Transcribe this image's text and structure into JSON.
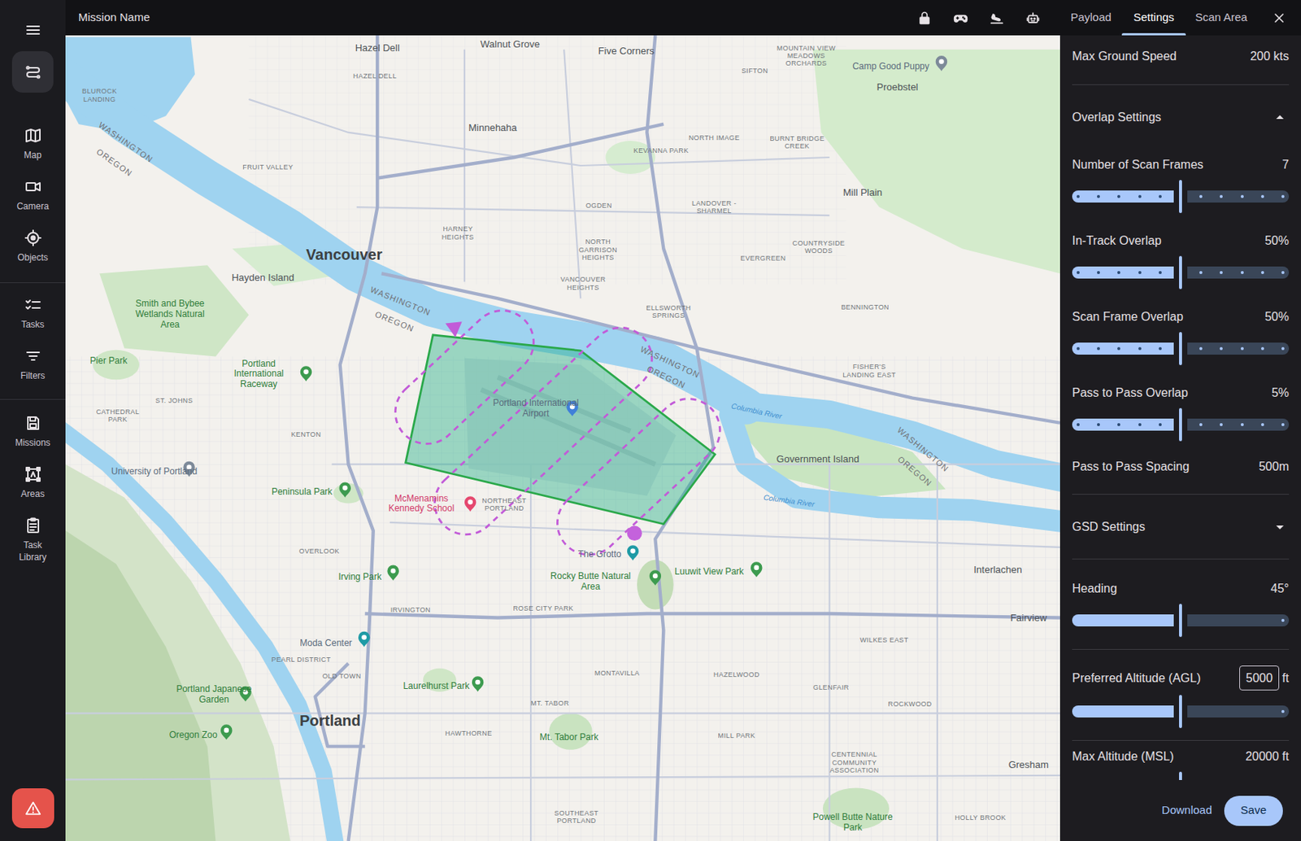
{
  "top_bar": {
    "title": "Mission Name"
  },
  "sidebar": {
    "layers_button": {
      "selected": true
    },
    "groups": [
      [
        {
          "label": "Map",
          "selected": false
        },
        {
          "label": "Camera",
          "selected": false
        },
        {
          "label": "Objects",
          "selected": false
        }
      ],
      [
        {
          "label": "Tasks",
          "selected": false
        },
        {
          "label": "Filters",
          "selected": false
        }
      ],
      [
        {
          "label": "Missions",
          "selected": false
        },
        {
          "label": "Areas",
          "selected": false
        },
        {
          "label": "Task Library",
          "selected": false
        }
      ]
    ]
  },
  "tabs": [
    {
      "label": "Payload",
      "selected": false
    },
    {
      "label": "Settings",
      "selected": true
    },
    {
      "label": "Scan Area",
      "selected": false
    }
  ],
  "settings": {
    "groups": [
      {
        "rows": [
          {
            "kind": "value",
            "label": "Max Ground Speed",
            "value": "200 kts"
          }
        ]
      },
      {
        "header": {
          "label": "Overlap Settings",
          "expanded": true
        },
        "rows": [
          {
            "kind": "stepped",
            "label": "Number of Scan Frames",
            "value": "7",
            "level": 0.5
          },
          {
            "kind": "stepped",
            "label": "In-Track Overlap",
            "value": "50%",
            "level": 0.5
          },
          {
            "kind": "stepped",
            "label": "Scan Frame Overlap",
            "value": "50%",
            "level": 0.5
          },
          {
            "kind": "stepped",
            "label": "Pass to Pass Overlap",
            "value": "5%",
            "level": 0.5
          },
          {
            "kind": "value",
            "label": "Pass to Pass Spacing",
            "value": "500m"
          }
        ]
      },
      {
        "header": {
          "label": "GSD Settings",
          "expanded": false
        },
        "rows": []
      },
      {
        "rows": [
          {
            "kind": "slider",
            "label": "Heading",
            "value": "45°",
            "level": 0.5
          }
        ]
      },
      {
        "rows": [
          {
            "kind": "input",
            "label": "Preferred Altitude (AGL)",
            "value": "5000",
            "unit": "ft",
            "level": 0.5
          }
        ]
      },
      {
        "rows": [
          {
            "kind": "slider",
            "label": "Max Altitude (MSL)",
            "value": "20000 ft",
            "level": 0.5
          }
        ]
      }
    ]
  },
  "footer": {
    "buttons": [
      {
        "label": "Download",
        "kind": "text"
      },
      {
        "label": "Save",
        "kind": "filled"
      }
    ]
  },
  "map": {
    "labels": [
      {
        "text": "Hazel Dell",
        "kind": "town"
      },
      {
        "text": "Walnut Grove",
        "kind": "town"
      },
      {
        "text": "Five Corners",
        "kind": "town"
      },
      {
        "text": "Minnehaha",
        "kind": "town"
      },
      {
        "text": "Vancouver",
        "kind": "city"
      },
      {
        "text": "Hayden Island",
        "kind": "town"
      },
      {
        "text": "Smith and Bybee Wetlands Natural Area",
        "kind": "park"
      },
      {
        "text": "Pier Park",
        "kind": "park"
      },
      {
        "text": "Portland International Raceway",
        "kind": "park"
      },
      {
        "text": "Portland International Airport",
        "kind": "poi"
      },
      {
        "text": "Government Island",
        "kind": "town"
      },
      {
        "text": "Mill Plain",
        "kind": "town"
      },
      {
        "text": "Proebstel",
        "kind": "town"
      },
      {
        "text": "Camp Good Puppy",
        "kind": "poi"
      },
      {
        "text": "Peninsula Park",
        "kind": "park"
      },
      {
        "text": "University of Portland",
        "kind": "poi"
      },
      {
        "text": "McMenamins Kennedy School",
        "kind": "red"
      },
      {
        "text": "The Grotto",
        "kind": "poi"
      },
      {
        "text": "Rocky Butte Natural Area",
        "kind": "park"
      },
      {
        "text": "Luuwit View Park",
        "kind": "park"
      },
      {
        "text": "Irving Park",
        "kind": "park"
      },
      {
        "text": "Moda Center",
        "kind": "poi"
      },
      {
        "text": "Laurelhurst Park",
        "kind": "park"
      },
      {
        "text": "Mt. Tabor Park",
        "kind": "park"
      },
      {
        "text": "Portland",
        "kind": "city"
      },
      {
        "text": "Portland Japanese Garden",
        "kind": "park"
      },
      {
        "text": "Oregon Zoo",
        "kind": "park"
      },
      {
        "text": "Interlachen",
        "kind": "town"
      },
      {
        "text": "Fairview",
        "kind": "town"
      },
      {
        "text": "Gresham",
        "kind": "town"
      },
      {
        "text": "Powell Butte Nature Park",
        "kind": "park"
      },
      {
        "text": "Columbia River",
        "kind": "water"
      },
      {
        "text": "Columbia River",
        "kind": "water"
      },
      {
        "text": "WASHINGTON",
        "kind": "state"
      },
      {
        "text": "OREGON",
        "kind": "state"
      },
      {
        "text": "WASHINGTON",
        "kind": "state"
      },
      {
        "text": "OREGON",
        "kind": "state"
      },
      {
        "text": "WASHINGTON",
        "kind": "state"
      },
      {
        "text": "OREGON",
        "kind": "state"
      },
      {
        "text": "WASHINGTON",
        "kind": "state"
      },
      {
        "text": "OREGON",
        "kind": "state"
      },
      {
        "text": "NORTH IMAGE",
        "kind": "hood"
      },
      {
        "text": "KEVANNA PARK",
        "kind": "hood"
      },
      {
        "text": "OGDEN",
        "kind": "hood"
      },
      {
        "text": "HARNEY HEIGHTS",
        "kind": "hood"
      },
      {
        "text": "NORTH GARRISON HEIGHTS",
        "kind": "hood"
      },
      {
        "text": "VANCOUVER HEIGHTS",
        "kind": "hood"
      },
      {
        "text": "ELLSWORTH SPRINGS",
        "kind": "hood"
      },
      {
        "text": "EVERGREEN",
        "kind": "hood"
      },
      {
        "text": "BENNINGTON",
        "kind": "hood"
      },
      {
        "text": "FISHER'S LANDING EAST",
        "kind": "hood"
      },
      {
        "text": "ST. JOHNS",
        "kind": "hood"
      },
      {
        "text": "KENTON",
        "kind": "hood"
      },
      {
        "text": "NORTHEAST PORTLAND",
        "kind": "hood"
      },
      {
        "text": "IRVINGTON",
        "kind": "hood"
      },
      {
        "text": "ROSE CITY PARK",
        "kind": "hood"
      },
      {
        "text": "MONTAVILLA",
        "kind": "hood"
      },
      {
        "text": "HAZELWOOD",
        "kind": "hood"
      },
      {
        "text": "MT. TABOR",
        "kind": "hood"
      },
      {
        "text": "HAWTHORNE",
        "kind": "hood"
      },
      {
        "text": "GLENFAIR",
        "kind": "hood"
      },
      {
        "text": "ROCKWOOD",
        "kind": "hood"
      },
      {
        "text": "WILKES EAST",
        "kind": "hood"
      },
      {
        "text": "PEARL DISTRICT",
        "kind": "hood"
      },
      {
        "text": "OLD TOWN",
        "kind": "hood"
      },
      {
        "text": "SOUTHEAST PORTLAND",
        "kind": "hood"
      },
      {
        "text": "OVERLOOK",
        "kind": "hood"
      },
      {
        "text": "FRUIT VALLEY",
        "kind": "hood"
      },
      {
        "text": "SIFTON",
        "kind": "hood"
      },
      {
        "text": "LANDOVER - SHARMEL",
        "kind": "hood"
      },
      {
        "text": "COUNTRYSIDE WOODS",
        "kind": "hood"
      },
      {
        "text": "BURNT BRIDGE CREEK",
        "kind": "hood"
      },
      {
        "text": "MILL PARK",
        "kind": "hood"
      },
      {
        "text": "HOLLY BROOK",
        "kind": "hood"
      },
      {
        "text": "CATHEDRAL PARK",
        "kind": "hood"
      },
      {
        "text": "MOUNTAIN VIEW MEADOWS ORCHARDS",
        "kind": "hood"
      },
      {
        "text": "HAZEL DELL",
        "kind": "hood"
      },
      {
        "text": "BLUROCK LANDING",
        "kind": "hood"
      },
      {
        "text": "CENTENNIAL COMMUNITY ASSOCIATION",
        "kind": "hood"
      }
    ]
  }
}
